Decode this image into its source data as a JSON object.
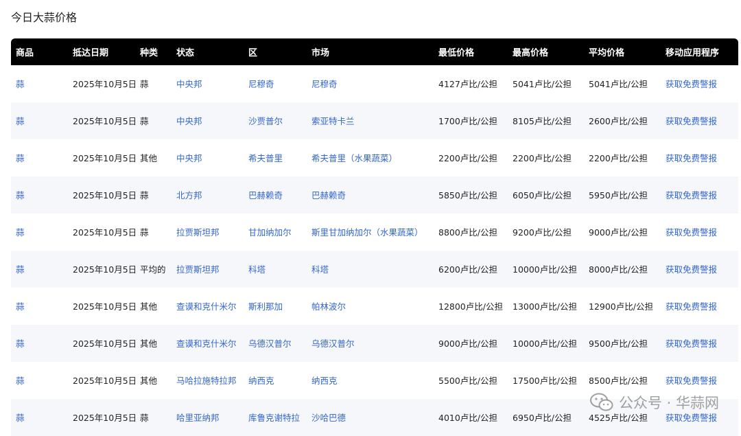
{
  "page": {
    "title": "今日大蒜价格"
  },
  "table": {
    "headers": [
      "商品",
      "抵达日期",
      "种类",
      "状态",
      "区",
      "市场",
      "最低价格",
      "最高价格",
      "平均价格",
      "移动应用程序"
    ],
    "rows": [
      [
        "蒜",
        "2025年10月5日",
        "蒜",
        "中央邦",
        "尼穆奇",
        "尼穆奇",
        "4127卢比/公担",
        "5041卢比/公担",
        "5041卢比/公担",
        "获取免费警报"
      ],
      [
        "蒜",
        "2025年10月5日",
        "蒜",
        "中央邦",
        "沙贾普尔",
        "索亚特卡兰",
        "1700卢比/公担",
        "8105卢比/公担",
        "2600卢比/公担",
        "获取免费警报"
      ],
      [
        "蒜",
        "2025年10月5日",
        "其他",
        "中央邦",
        "希夫普里",
        "希夫普里（水果蔬菜）",
        "2200卢比/公担",
        "2200卢比/公担",
        "2200卢比/公担",
        "获取免费警报"
      ],
      [
        "蒜",
        "2025年10月5日",
        "蒜",
        "北方邦",
        "巴赫赖奇",
        "巴赫赖奇",
        "5850卢比/公担",
        "6050卢比/公担",
        "5950卢比/公担",
        "获取免费警报"
      ],
      [
        "蒜",
        "2025年10月5日",
        "蒜",
        "拉贾斯坦邦",
        "甘加纳加尔",
        "斯里甘加纳加尔（水果蔬菜）",
        "8800卢比/公担",
        "9200卢比/公担",
        "9000卢比/公担",
        "获取免费警报"
      ],
      [
        "蒜",
        "2025年10月5日",
        "平均的",
        "拉贾斯坦邦",
        "科塔",
        "科塔",
        "6200卢比/公担",
        "10000卢比/公担",
        "8000卢比/公担",
        "获取免费警报"
      ],
      [
        "蒜",
        "2025年10月5日",
        "其他",
        "查谟和克什米尔",
        "斯利那加",
        "帕林波尔",
        "12800卢比/公担",
        "13000卢比/公担",
        "12900卢比/公担",
        "获取免费警报"
      ],
      [
        "蒜",
        "2025年10月5日",
        "其他",
        "查谟和克什米尔",
        "乌德汉普尔",
        "乌德汉普尔",
        "9000卢比/公担",
        "10000卢比/公担",
        "9500卢比/公担",
        "获取免费警报"
      ],
      [
        "蒜",
        "2025年10月5日",
        "其他",
        "马哈拉施特拉邦",
        "纳西克",
        "纳西克",
        "5500卢比/公担",
        "17500卢比/公担",
        "8500卢比/公担",
        "获取免费警报"
      ],
      [
        "蒜",
        "2025年10月5日",
        "蒜",
        "哈里亚纳邦",
        "库鲁克谢特拉",
        "沙哈巴德",
        "4010卢比/公担",
        "6950卢比/公担",
        "4525卢比/公担",
        "获取免费警报"
      ]
    ]
  },
  "watermark": {
    "text": "公众号 · 华蒜网",
    "icon": "wechat-icon"
  },
  "colors": {
    "link": "#3366cc",
    "header_bg": "#000000",
    "stripe": "#f6f7fb"
  }
}
